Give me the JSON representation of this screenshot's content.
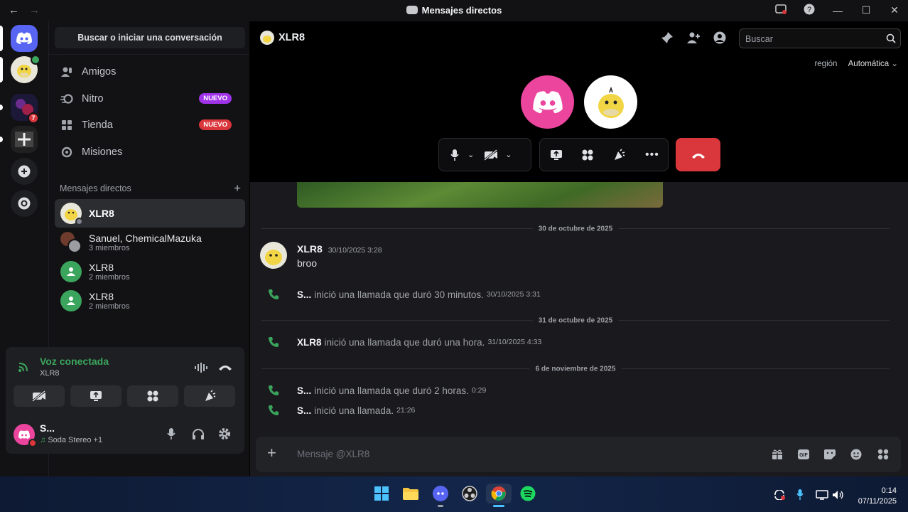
{
  "titlebar": {
    "title": "Mensajes directos",
    "back": "←",
    "forward": "→"
  },
  "dm_panel": {
    "search_label": "Buscar o iniciar una conversación",
    "nav": [
      {
        "label": "Amigos",
        "icon": "friends-icon"
      },
      {
        "label": "Nitro",
        "icon": "nitro-icon",
        "badge": "NUEVO"
      },
      {
        "label": "Tienda",
        "icon": "shop-icon",
        "badge": "NUEVO"
      },
      {
        "label": "Misiones",
        "icon": "quests-icon"
      }
    ],
    "dm_header": "Mensajes directos",
    "conversations": [
      {
        "name": "XLR8",
        "sub": ""
      },
      {
        "name": "Sanuel, ChemicalMazuka",
        "sub": "3 miembros"
      },
      {
        "name": "XLR8",
        "sub": "2 miembros"
      },
      {
        "name": "XLR8",
        "sub": "2 miembros"
      }
    ]
  },
  "servers": {
    "notification_count": "7"
  },
  "voice": {
    "status": "Voz conectada",
    "channel": "XLR8"
  },
  "user": {
    "name": "S...",
    "activity": "Soda Stereo +1"
  },
  "chat": {
    "header_name": "XLR8",
    "search_placeholder": "Buscar",
    "region_label": "región",
    "region_value": "Automática",
    "messages": {
      "date1": "30 de octubre de 2025",
      "author": "XLR8",
      "author_time": "30/10/2025 3:28",
      "text": "broo",
      "call1_user": "S...",
      "call1_text": "inició una llamada que duró 30 minutos.",
      "call1_time": "30/10/2025 3:31",
      "date2": "31 de octubre de 2025",
      "call2_user": "XLR8",
      "call2_text": "inició una llamada que duró una hora.",
      "call2_time": "31/10/2025 4:33",
      "date3": "6 de noviembre de 2025",
      "call3_user": "S...",
      "call3_text": "inició una llamada que duró 2 horas.",
      "call3_time": "0:29",
      "call4_user": "S...",
      "call4_text": "inició una llamada.",
      "call4_time": "21:26"
    },
    "composer_placeholder": "Mensaje @XLR8"
  },
  "taskbar": {
    "time": "0:14",
    "date": "07/11/2025"
  },
  "colors": {
    "blurple": "#5865f2",
    "green": "#3ba55d",
    "red": "#da373c",
    "pink": "#eb459e",
    "nitro_badge": "#a033e8"
  }
}
